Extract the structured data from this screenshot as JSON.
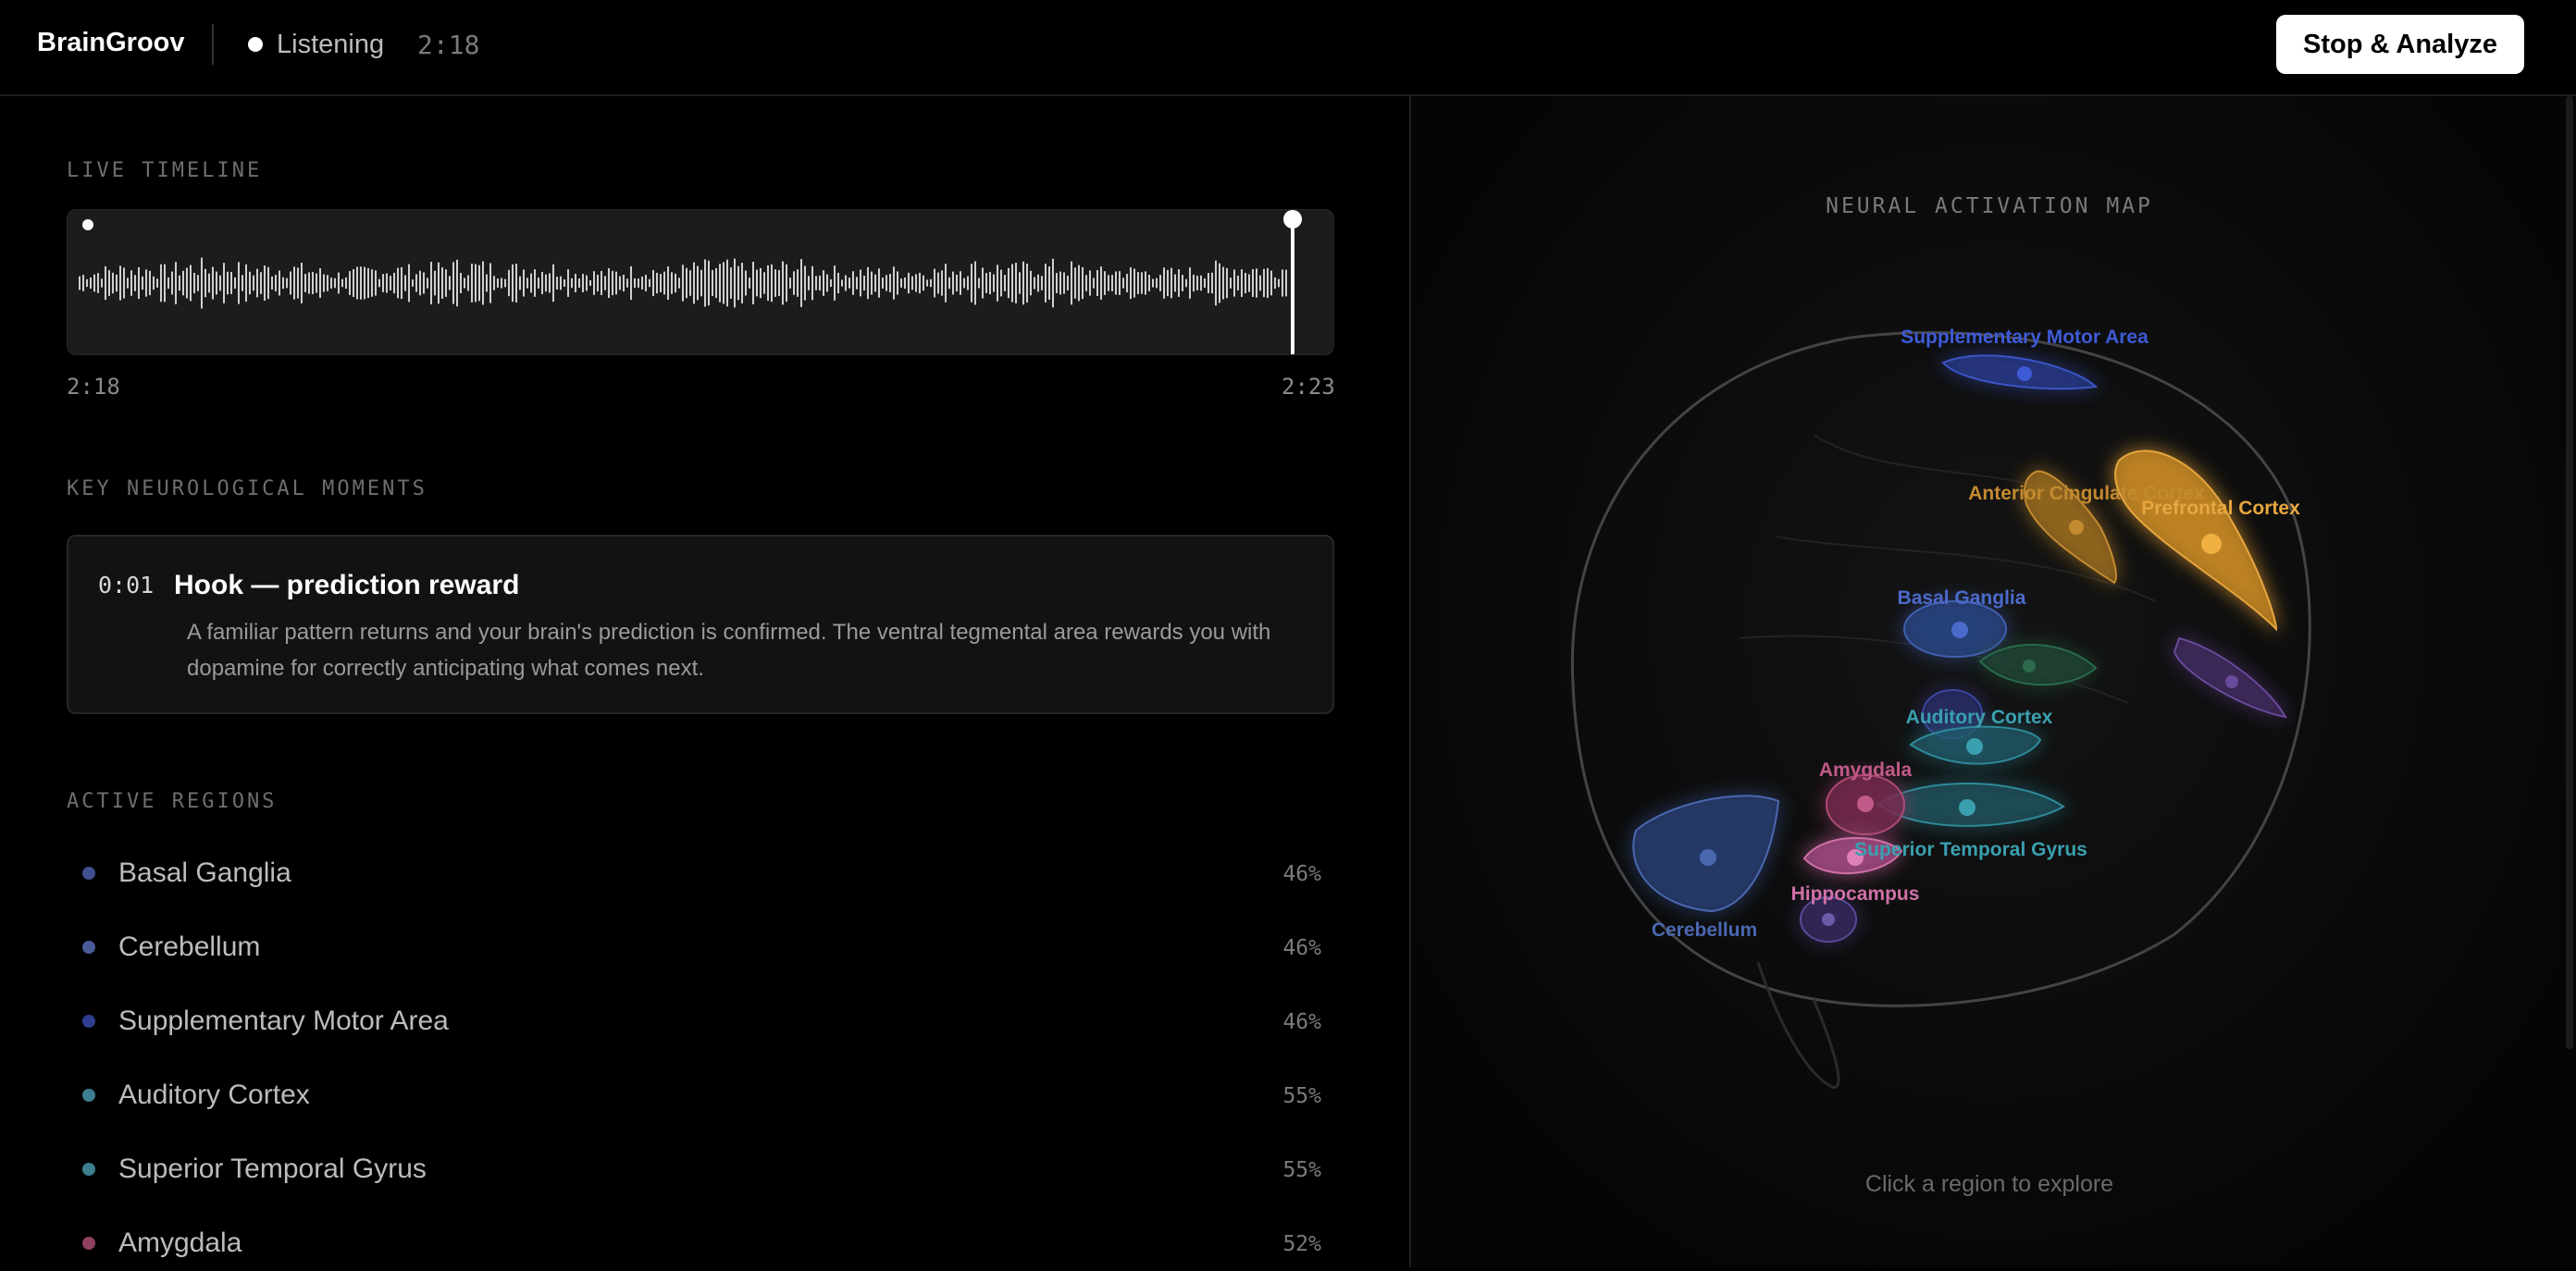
{
  "header": {
    "brand": "BrainGroov",
    "status_label": "Listening",
    "elapsed": "2:18",
    "stop_button": "Stop & Analyze"
  },
  "timeline": {
    "label": "LIVE TIMELINE",
    "start_time": "2:18",
    "end_time": "2:23",
    "playhead_progress": 0.965
  },
  "moments": {
    "label": "KEY NEUROLOGICAL MOMENTS",
    "items": [
      {
        "time": "0:01",
        "title": "Hook — prediction reward",
        "description": "A familiar pattern returns and your brain's prediction is confirmed. The ventral tegmental area rewards you with dopamine for correctly anticipating what comes next."
      }
    ]
  },
  "regions": {
    "label": "ACTIVE REGIONS",
    "items": [
      {
        "name": "Basal Ganglia",
        "percent": "46%",
        "color": "#3f4f8f"
      },
      {
        "name": "Cerebellum",
        "percent": "46%",
        "color": "#4a5a99"
      },
      {
        "name": "Supplementary Motor Area",
        "percent": "46%",
        "color": "#2f3f8f"
      },
      {
        "name": "Auditory Cortex",
        "percent": "55%",
        "color": "#3d7f8f"
      },
      {
        "name": "Superior Temporal Gyrus",
        "percent": "55%",
        "color": "#3d7f8f"
      },
      {
        "name": "Amygdala",
        "percent": "52%",
        "color": "#8f3f5f"
      }
    ]
  },
  "map": {
    "title": "NEURAL ACTIVATION MAP",
    "hint": "Click a region to explore",
    "labels": {
      "sma": "Supplementary Motor Area",
      "acc": "Anterior Cingulate Cortex",
      "pfc": "Prefrontal Cortex",
      "basal": "Basal Ganglia",
      "auditory": "Auditory Cortex",
      "amygdala": "Amygdala",
      "stg": "Superior Temporal Gyrus",
      "hippocampus": "Hippocampus",
      "cerebellum": "Cerebellum"
    }
  }
}
